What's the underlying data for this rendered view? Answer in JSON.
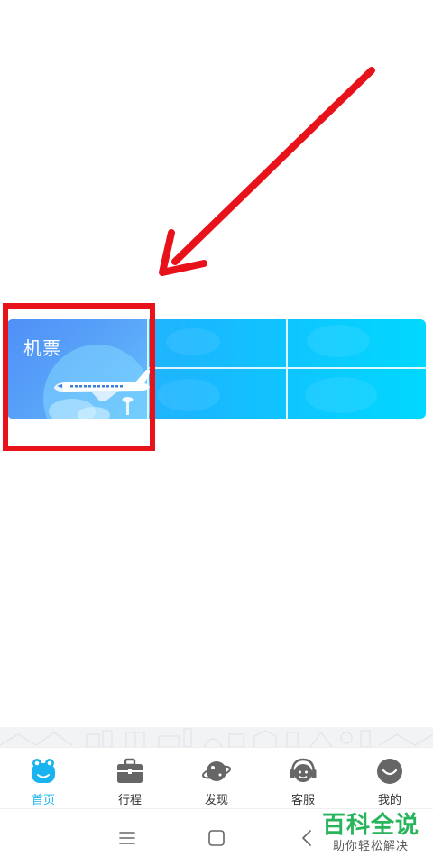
{
  "services": {
    "flight": {
      "label": "机票"
    }
  },
  "tabbar": {
    "items": [
      {
        "label": "首页",
        "icon": "home-face-icon",
        "active": true
      },
      {
        "label": "行程",
        "icon": "briefcase-icon",
        "active": false
      },
      {
        "label": "发现",
        "icon": "planet-icon",
        "active": false
      },
      {
        "label": "客服",
        "icon": "headset-icon",
        "active": false
      },
      {
        "label": "我的",
        "icon": "smile-icon",
        "active": false
      }
    ]
  },
  "watermark": {
    "title": "百科全说",
    "subtitle": "助你轻松解决"
  },
  "colors": {
    "accent": "#19b3f0",
    "highlight": "#e8121b",
    "watermark": "#27b45a"
  }
}
